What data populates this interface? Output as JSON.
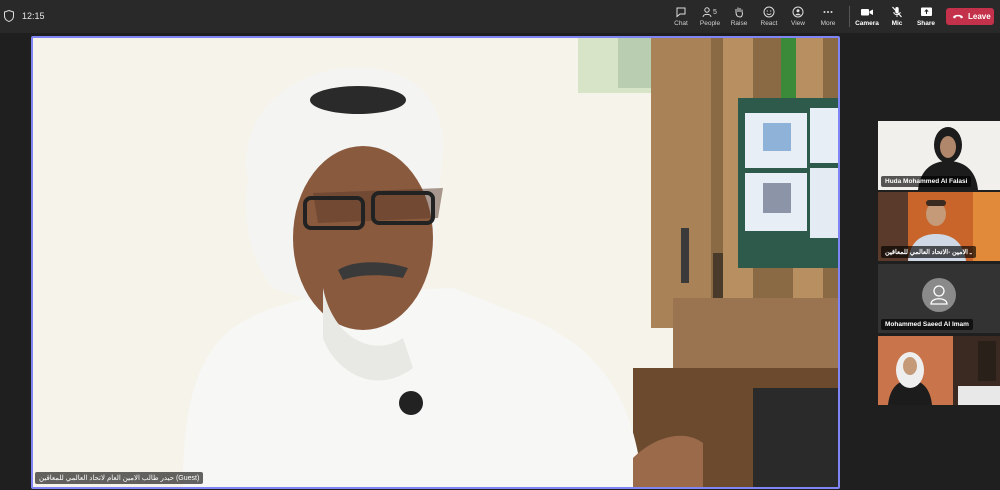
{
  "topbar": {
    "time": "12:15",
    "people_count": "5",
    "buttons": {
      "chat": "Chat",
      "people": "People",
      "raise": "Raise",
      "react": "React",
      "view": "View",
      "more": "More",
      "camera": "Camera",
      "mic": "Mic",
      "share": "Share",
      "leave": "Leave"
    },
    "leave_color": "#c4314b"
  },
  "main": {
    "speaker_name": "حيدر طالب الامين العام لاتحاد العالمي للمعاقين (Guest)",
    "active_border_color": "#7f85f5"
  },
  "participants": [
    {
      "name": "Huda Mohammed Al Falasi",
      "video": true
    },
    {
      "name": "ـ الامين -الاتحاد العالمي للمعاقين",
      "video": true
    },
    {
      "name": "Mohammed Saeed Al Imam",
      "video": false,
      "icon": "person-icon"
    },
    {
      "name": "",
      "video": true
    }
  ]
}
